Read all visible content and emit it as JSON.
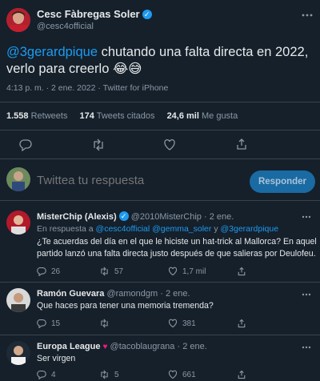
{
  "tweet": {
    "author_name": "Cesc Fàbregas Soler",
    "author_handle": "@cesc4official",
    "mention": "@3gerardpique",
    "text_line1": " chutando una falta directa en 2022,",
    "text_line2": "verlo para creerlo 😂😅",
    "time": "4:13 p. m. · 2 ene. 2022 · Twitter for iPhone"
  },
  "stats": {
    "retweets_count": "1.558",
    "retweets_label": "Retweets",
    "quotes_count": "174",
    "quotes_label": "Tweets citados",
    "likes_count": "24,6 mil",
    "likes_label": "Me gusta"
  },
  "compose": {
    "placeholder": "Twittea tu respuesta",
    "button_label": "Responder"
  },
  "replies": [
    {
      "name": "MisterChip (Alexis)",
      "handle": "@2010MisterChip",
      "date": "· 2 ene.",
      "reply_to_prefix": "En respuesta a ",
      "reply_to_handles": "@cesc4official @gemma_soler",
      "reply_to_and": " y ",
      "reply_to_last": "@3gerardpique",
      "text_line1": "¿Te acuerdas del día en el que le hiciste un hat-trick al Mallorca? En aquel",
      "text_line2": "partido lanzó una falta directa justo después de que salieras por Deulofeu.",
      "replies": "26",
      "retweets": "57",
      "likes": "1,7 mil"
    },
    {
      "name": "Ramón Guevara",
      "handle": "@ramondgm",
      "date": "· 2 ene.",
      "text": "Que haces para tener una memoria tremenda?",
      "replies": "15",
      "retweets": "",
      "likes": "381"
    },
    {
      "name": "Europa League",
      "handle": "@tacoblaugrana",
      "date": "· 2 ene.",
      "text": "Ser virgen",
      "replies": "4",
      "retweets": "5",
      "likes": "661"
    }
  ],
  "colors": {
    "background": "#15202b",
    "accent": "#1d9bf0",
    "divider": "#38444d",
    "muted": "#8b98a5",
    "heart": "#f91880"
  }
}
